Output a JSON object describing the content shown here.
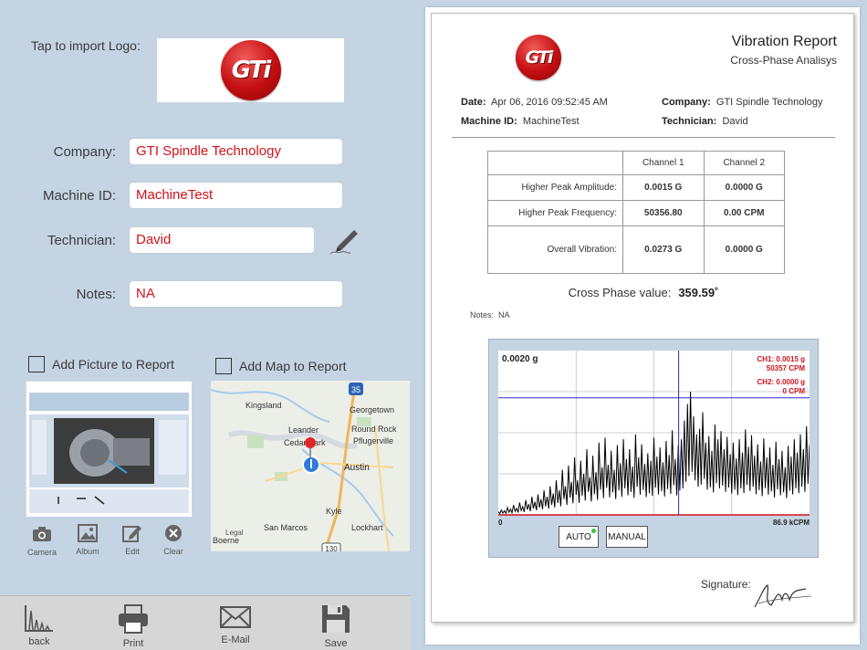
{
  "form": {
    "logo_prompt": "Tap to import Logo:",
    "logo_text": "GTi",
    "company_label": "Company:",
    "company_value": "GTI Spindle Technology",
    "machine_label": "Machine ID:",
    "machine_value": "MachineTest",
    "technician_label": "Technician:",
    "technician_value": "David",
    "notes_label": "Notes:",
    "notes_value": "NA",
    "add_picture_label": "Add Picture to Report",
    "add_map_label": "Add Map to Report"
  },
  "picture_tools": [
    {
      "label": "Camera",
      "icon": "camera-icon"
    },
    {
      "label": "Album",
      "icon": "album-icon"
    },
    {
      "label": "Edit",
      "icon": "edit-icon"
    },
    {
      "label": "Clear",
      "icon": "clear-icon"
    }
  ],
  "map": {
    "places": [
      "Kingsland",
      "Georgetown",
      "Leander",
      "Round Rock",
      "Cedar Park",
      "Pflugerville",
      "Austin",
      "Kyle",
      "San Marcos",
      "Lockhart",
      "Boerne",
      "Legal"
    ],
    "highways": [
      "35",
      "130"
    ]
  },
  "bottom_bar": [
    {
      "label": "back",
      "icon": "chart-icon"
    },
    {
      "label": "Print",
      "icon": "printer-icon"
    },
    {
      "label": "E-Mail",
      "icon": "envelope-icon"
    },
    {
      "label": "Save",
      "icon": "floppy-icon"
    }
  ],
  "report": {
    "title": "Vibration Report",
    "subtitle": "Cross-Phase Analisys",
    "date_label": "Date:",
    "date_value": "Apr 06, 2016  09:52:45 AM",
    "company_label": "Company:",
    "company_value": "GTI Spindle Technology",
    "machine_label": "Machine ID:",
    "machine_value": "MachineTest",
    "technician_label": "Technician:",
    "technician_value": "David",
    "table": {
      "headers": [
        "",
        "Channel 1",
        "Channel 2"
      ],
      "rows": [
        [
          "Higher Peak Amplitude:",
          "0.0015 G",
          "0.0000 G"
        ],
        [
          "Higher Peak Frequency:",
          "50356.80",
          "0.00 CPM"
        ],
        [
          "Overall Vibration:",
          "0.0273 G",
          "0.0000 G"
        ]
      ]
    },
    "cross_phase_label": "Cross Phase value:",
    "cross_phase_value": "359.59˚",
    "notes_label": "Notes:",
    "notes_value": "NA",
    "signature_label": "Signature:"
  },
  "chart": {
    "y_max_label": "0.0020 g",
    "x_min_label": "0",
    "x_max_label": "86.9 kCPM",
    "ch1_line1": "CH1: 0.0015 g",
    "ch1_line2": "50357 CPM",
    "ch2_line1": "CH2: 0.0000 g",
    "ch2_line2": "0 CPM",
    "auto_label": "AUTO",
    "manual_label": "MANUAL",
    "colors": {
      "trace": "#000000",
      "cursor": "#2b2bd9",
      "baseline": "#d0131a",
      "label": "#d0131a",
      "led": "#3cc63c"
    }
  },
  "chart_data": {
    "type": "line",
    "title": "",
    "xlabel": "",
    "ylabel": "",
    "xlim": [
      0,
      86.9
    ],
    "ylim": [
      0,
      0.002
    ],
    "grid": true,
    "cursor_x": 50.357,
    "series": [
      {
        "values": [
          4e-05,
          6e-05,
          5e-05,
          9e-05,
          7e-05,
          0.00012,
          8e-05,
          0.00015,
          0.0001,
          0.00018,
          0.00013,
          0.00022,
          0.00016,
          0.00025,
          0.00019,
          0.0003,
          0.00022,
          0.00035,
          0.00026,
          0.00042,
          0.0003,
          0.00055,
          0.00035,
          0.0006,
          0.0004,
          0.0007,
          0.00042,
          0.00066,
          0.0005,
          0.0008,
          0.00046,
          0.00072,
          0.00052,
          0.00088,
          0.00058,
          0.00094,
          0.00061,
          0.00078,
          0.00055,
          0.00085,
          0.00063,
          0.00092,
          0.00068,
          0.0008,
          0.00059,
          0.00098,
          0.0007,
          0.00086,
          0.00062,
          0.00075,
          0.00066,
          0.00094,
          0.00071,
          0.00082,
          0.00064,
          0.0009,
          0.00073,
          0.00103,
          0.00068,
          0.00085,
          0.00092,
          0.00115,
          0.00135,
          0.0015,
          0.0012,
          0.00098,
          0.00105,
          0.00125,
          0.00088,
          0.00096,
          0.00078,
          0.0011,
          0.00092,
          0.00102,
          0.0008,
          0.00095,
          0.00074,
          0.00088,
          0.00069,
          0.00092,
          0.00076,
          0.00104,
          0.00083,
          0.00097,
          0.00072,
          0.00086,
          0.00065,
          0.00093,
          0.0007,
          0.00082,
          0.00061,
          0.00089,
          0.00068,
          0.00078,
          0.00058,
          0.00084,
          0.00071,
          0.00092,
          0.00076,
          0.00098,
          0.0008,
          0.00108,
          0.00085
        ]
      }
    ]
  },
  "colors": {
    "background": "#c5d4e3",
    "field_text": "#d0131a",
    "bottom_bar": "#d6d6d6"
  }
}
